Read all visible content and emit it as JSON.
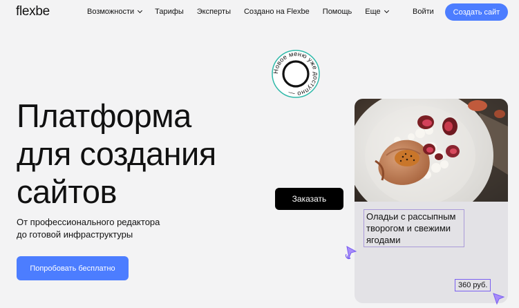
{
  "nav": {
    "logo": "flexbe",
    "items": [
      {
        "label": "Возможности",
        "dropdown": true
      },
      {
        "label": "Тарифы",
        "dropdown": false
      },
      {
        "label": "Эксперты",
        "dropdown": false
      },
      {
        "label": "Создано на Flexbe",
        "dropdown": false
      },
      {
        "label": "Помощь",
        "dropdown": false
      },
      {
        "label": "Еще",
        "dropdown": true
      }
    ],
    "login": "Войти",
    "create_site": "Создать сайт"
  },
  "hero": {
    "title_lines": [
      "Платформа",
      "для создания",
      "сайтов"
    ],
    "subtitle_lines": [
      "От профессионального редактора",
      "до готовой инфраструктуры"
    ],
    "cta": "Попробовать бесплатно"
  },
  "badge": {
    "text": "Новое меню уже доступно — "
  },
  "order_button": "Заказать",
  "card": {
    "title_lines": [
      "Оладьи с рассыпным",
      "творогом и свежими",
      "ягодами"
    ],
    "price": "360 руб."
  },
  "colors": {
    "accent": "#4c7dff",
    "background": "#f3f3f4",
    "card": "#e3e2e6",
    "badge_ring": "#2fb9a9",
    "selection": "#7a5ff0"
  }
}
